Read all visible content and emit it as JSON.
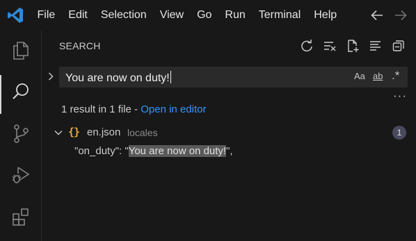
{
  "menu": [
    "File",
    "Edit",
    "Selection",
    "View",
    "Go",
    "Run",
    "Terminal",
    "Help"
  ],
  "sidebar": {
    "title": "SEARCH",
    "search_value": "You are now on duty!",
    "options": {
      "case": "Aa",
      "word": "ab",
      "regex": ".*"
    },
    "more": "···",
    "summary_text": "1 result in 1 file - ",
    "open_in_editor": "Open in editor",
    "file": {
      "icon": "{}",
      "name": "en.json",
      "path": "locales",
      "count": "1"
    },
    "match": {
      "prefix": "\"on_duty\": \"",
      "highlight": "You are now on duty!",
      "suffix": "\","
    }
  },
  "colors": {
    "accent": "#3794ff",
    "json_icon": "#e8ab3c",
    "highlight": "#5a5a5a",
    "logo": "#2f8ad8"
  },
  "icons": [
    "vscode-logo-icon",
    "arrow-left-icon",
    "arrow-right-icon",
    "explorer-icon",
    "search-icon",
    "source-control-icon",
    "run-debug-icon",
    "extensions-icon",
    "refresh-icon",
    "clear-results-icon",
    "new-search-editor-icon",
    "view-as-tree-icon",
    "collapse-all-icon",
    "chevron-right-icon",
    "chevron-down-icon"
  ]
}
